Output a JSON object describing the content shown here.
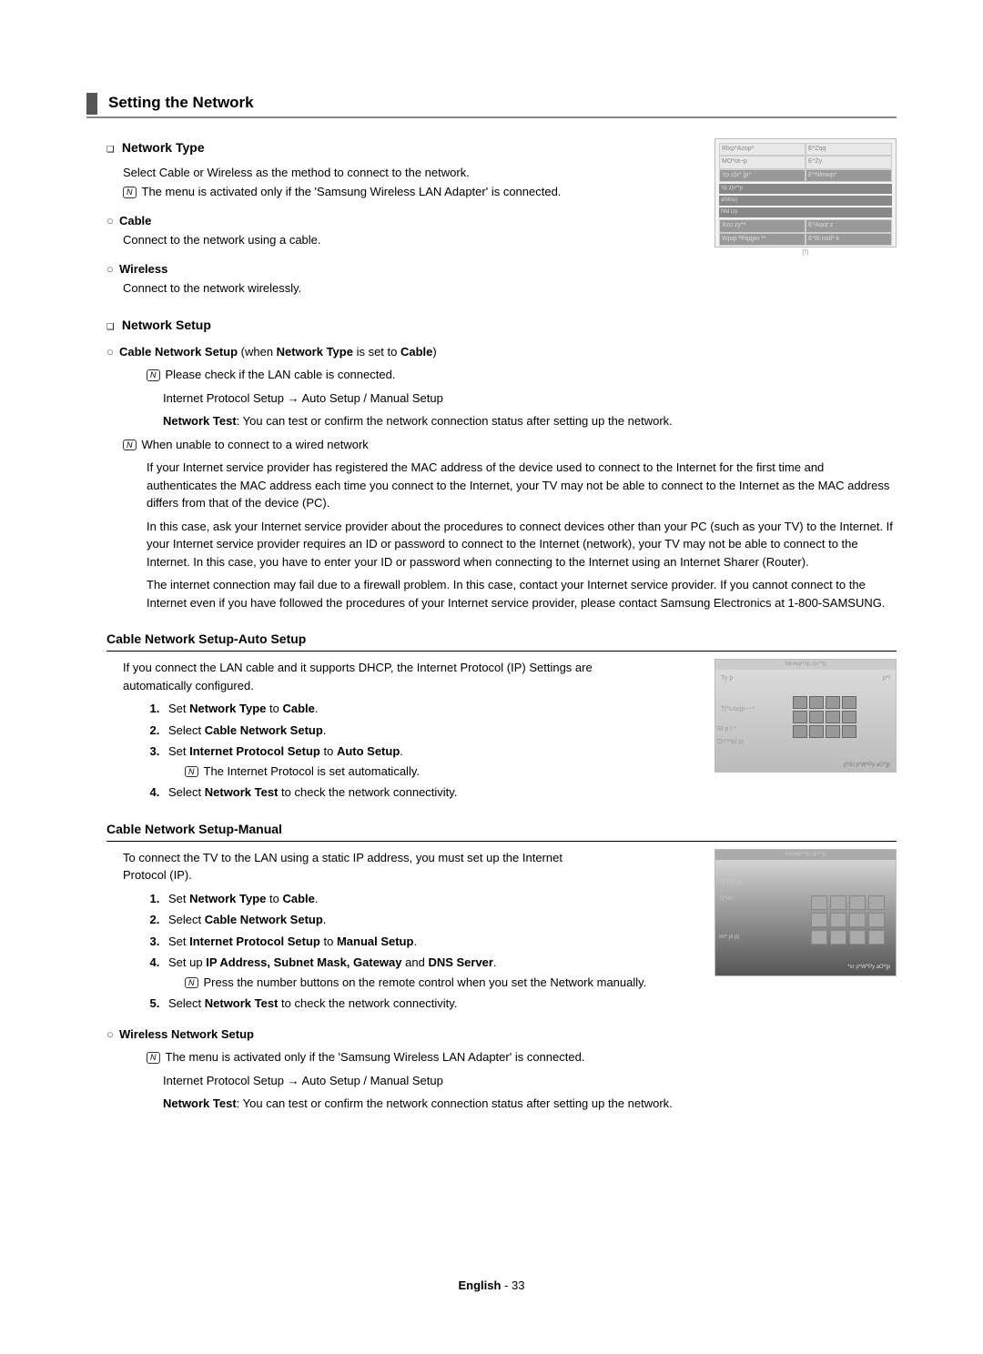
{
  "header": {
    "title": "Setting the Network"
  },
  "networkType": {
    "heading": "Network Type",
    "intro": "Select Cable or Wireless as the method to connect to the network.",
    "note": "The menu is activated only if the 'Samsung Wireless LAN Adapter' is connected.",
    "cable": {
      "title": "Cable",
      "desc": "Connect to the network using a cable."
    },
    "wireless": {
      "title": "Wireless",
      "desc": "Connect to the network wirelessly."
    }
  },
  "networkSetup": {
    "heading": "Network Setup",
    "cableSetup": {
      "title_prefix": "Cable Network Setup",
      "title_mid": " (when ",
      "title_b2": "Network Type",
      "title_mid2": " is set to ",
      "title_b3": "Cable",
      "title_suffix": ")",
      "note1": "Please check if the LAN cable is connected.",
      "line2": "Internet Protocol Setup →    Auto Setup / Manual Setup",
      "line3_b": "Network Test",
      "line3_rest": ": You can test or confirm the network connection status after setting up the network.",
      "note2_title": "When unable to connect to a wired network",
      "p1": "If your Internet service provider has registered the MAC address of the device used to connect to the Internet for the first time and authenticates the MAC address each time you connect to the Internet, your TV may not be able to connect to the Internet as the MAC address differs from that of the device (PC).",
      "p2": "In this case, ask your Internet service provider about the procedures to connect devices other than your PC (such as your TV) to the Internet. If your Internet service provider requires an ID or password to connect to the Internet (network), your TV may not be able to connect to the Internet. In this case, you have to enter your ID or password when connecting to the Internet using an Internet Sharer (Router).",
      "p3": "The internet connection may fail due to a firewall problem. In this case, contact your Internet service provider. If you cannot connect to the Internet even if you have followed the procedures of your Internet service provider, please contact Samsung Electronics at 1-800-SAMSUNG."
    },
    "autoSetup": {
      "heading": "Cable Network Setup-Auto Setup",
      "intro": "If you connect the LAN cable and it supports DHCP, the Internet Protocol (IP) Settings are automatically configured.",
      "s1a": "Set ",
      "s1b": "Network Type",
      "s1c": " to ",
      "s1d": "Cable",
      "s1e": ".",
      "s2a": "Select ",
      "s2b": "Cable Network Setup",
      "s2c": ".",
      "s3a": "Set ",
      "s3b": "Internet Protocol Setup",
      "s3c": " to ",
      "s3d": "Auto Setup",
      "s3e": ".",
      "s3note": "The Internet Protocol is set automatically.",
      "s4a": "Select ",
      "s4b": "Network Test",
      "s4c": " to check the network connectivity."
    },
    "manualSetup": {
      "heading": "Cable Network Setup-Manual",
      "intro": "To connect the TV to the LAN using a static IP address, you must set up the Internet Protocol (IP).",
      "s1a": "Set ",
      "s1b": "Network Type",
      "s1c": " to ",
      "s1d": "Cable",
      "s1e": ".",
      "s2a": "Select ",
      "s2b": "Cable Network Setup",
      "s2c": ".",
      "s3a": "Set ",
      "s3b": "Internet Protocol Setup",
      "s3c": " to ",
      "s3d": "Manual Setup",
      "s3e": ".",
      "s4a": "Set up ",
      "s4b": "IP Address, Subnet Mask, Gateway",
      "s4c": " and ",
      "s4d": "DNS Server",
      "s4e": ".",
      "s4note": "Press the number buttons on the remote control when you set the Network manually.",
      "s5a": "Select ",
      "s5b": "Network Test",
      "s5c": " to check the network connectivity."
    },
    "wirelessSetup": {
      "title": "Wireless Network Setup",
      "note": "The menu is activated only if the 'Samsung Wireless LAN Adapter' is connected.",
      "line2": "Internet Protocol Setup →    Auto Setup / Manual Setup",
      "line3_b": "Network Test",
      "line3_rest": ": You can test or confirm the network connection status after setting up the network."
    }
  },
  "footer": {
    "lang": "English",
    "sep": " - ",
    "page": "33"
  }
}
